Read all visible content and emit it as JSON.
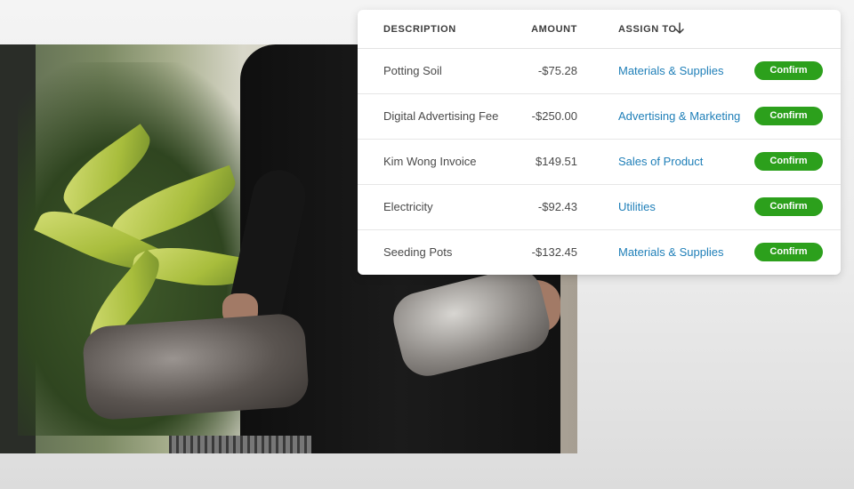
{
  "table": {
    "headers": {
      "description": "DESCRIPTION",
      "amount": "AMOUNT",
      "assign_to": "ASSIGN TO"
    },
    "sort_icon": "arrow-down-icon",
    "rows": [
      {
        "description": "Potting Soil",
        "amount": "-$75.28",
        "category": "Materials & Supplies",
        "action": "Confirm"
      },
      {
        "description": "Digital Advertising Fee",
        "amount": "-$250.00",
        "category": "Advertising & Marketing",
        "action": "Confirm"
      },
      {
        "description": "Kim Wong Invoice",
        "amount": "$149.51",
        "category": "Sales of Product",
        "action": "Confirm"
      },
      {
        "description": "Electricity",
        "amount": "-$92.43",
        "category": "Utilities",
        "action": "Confirm"
      },
      {
        "description": "Seeding Pots",
        "amount": "-$132.45",
        "category": "Materials & Supplies",
        "action": "Confirm"
      }
    ]
  },
  "colors": {
    "confirm_button": "#2ca01c",
    "category_link": "#1f7fb8"
  }
}
